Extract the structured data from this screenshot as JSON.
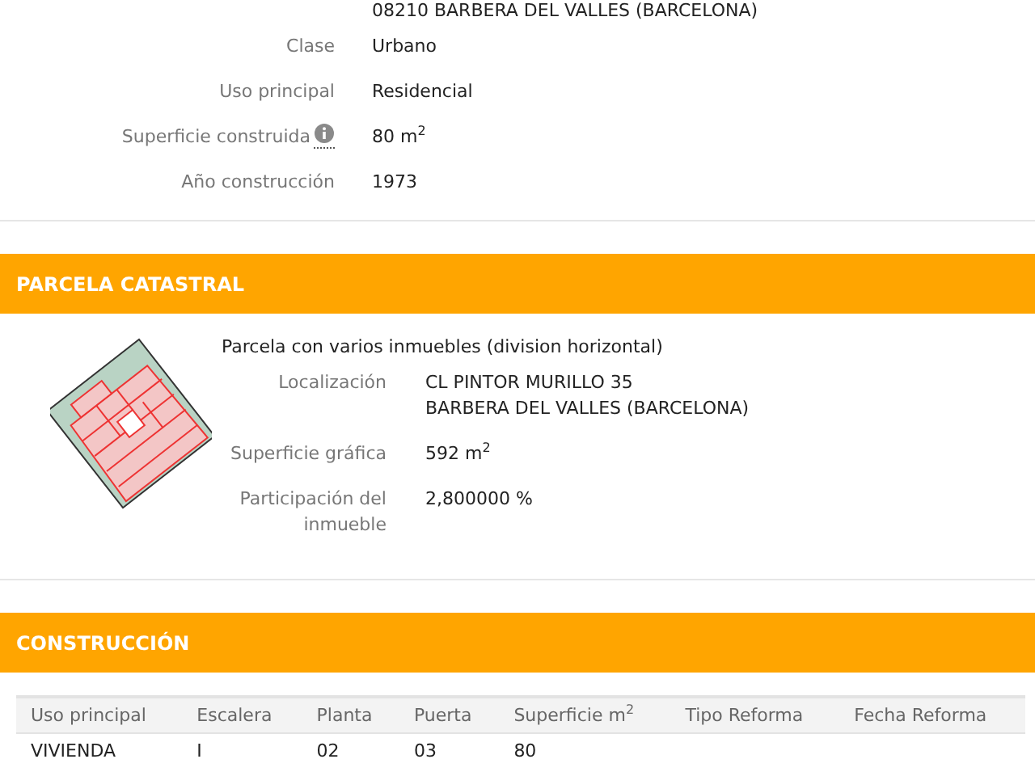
{
  "property": {
    "address_line": "08210 BARBERA DEL VALLES (BARCELONA)",
    "fields": [
      {
        "label": "Clase",
        "value": "Urbano",
        "info": false
      },
      {
        "label": "Uso principal",
        "value": "Residencial",
        "info": false
      },
      {
        "label": "Superficie construida",
        "value": "80 m$^{2}$",
        "info": true
      },
      {
        "label": "Año construcción",
        "value": "1973",
        "info": false
      }
    ]
  },
  "parcel": {
    "title": "PARCELA CATASTRAL",
    "description": "Parcela con varios inmuebles (division horizontal)",
    "fields": [
      {
        "label": "Localización",
        "lines": [
          "CL PINTOR MURILLO 35",
          "BARBERA DEL VALLES (BARCELONA)"
        ]
      },
      {
        "label": "Superficie gráfica",
        "lines": [
          "592 m$^{2}$"
        ]
      },
      {
        "label": "Participación del inmueble",
        "lines": [
          "2,800000 %"
        ]
      }
    ]
  },
  "construction": {
    "title": "CONSTRUCCIÓN",
    "columns": [
      "Uso principal",
      "Escalera",
      "Planta",
      "Puerta",
      "Superficie m$^{2}$",
      "Tipo Reforma",
      "Fecha Reforma"
    ],
    "rows": [
      [
        "VIVIENDA",
        "I",
        "02",
        "03",
        "80",
        "",
        ""
      ]
    ]
  }
}
